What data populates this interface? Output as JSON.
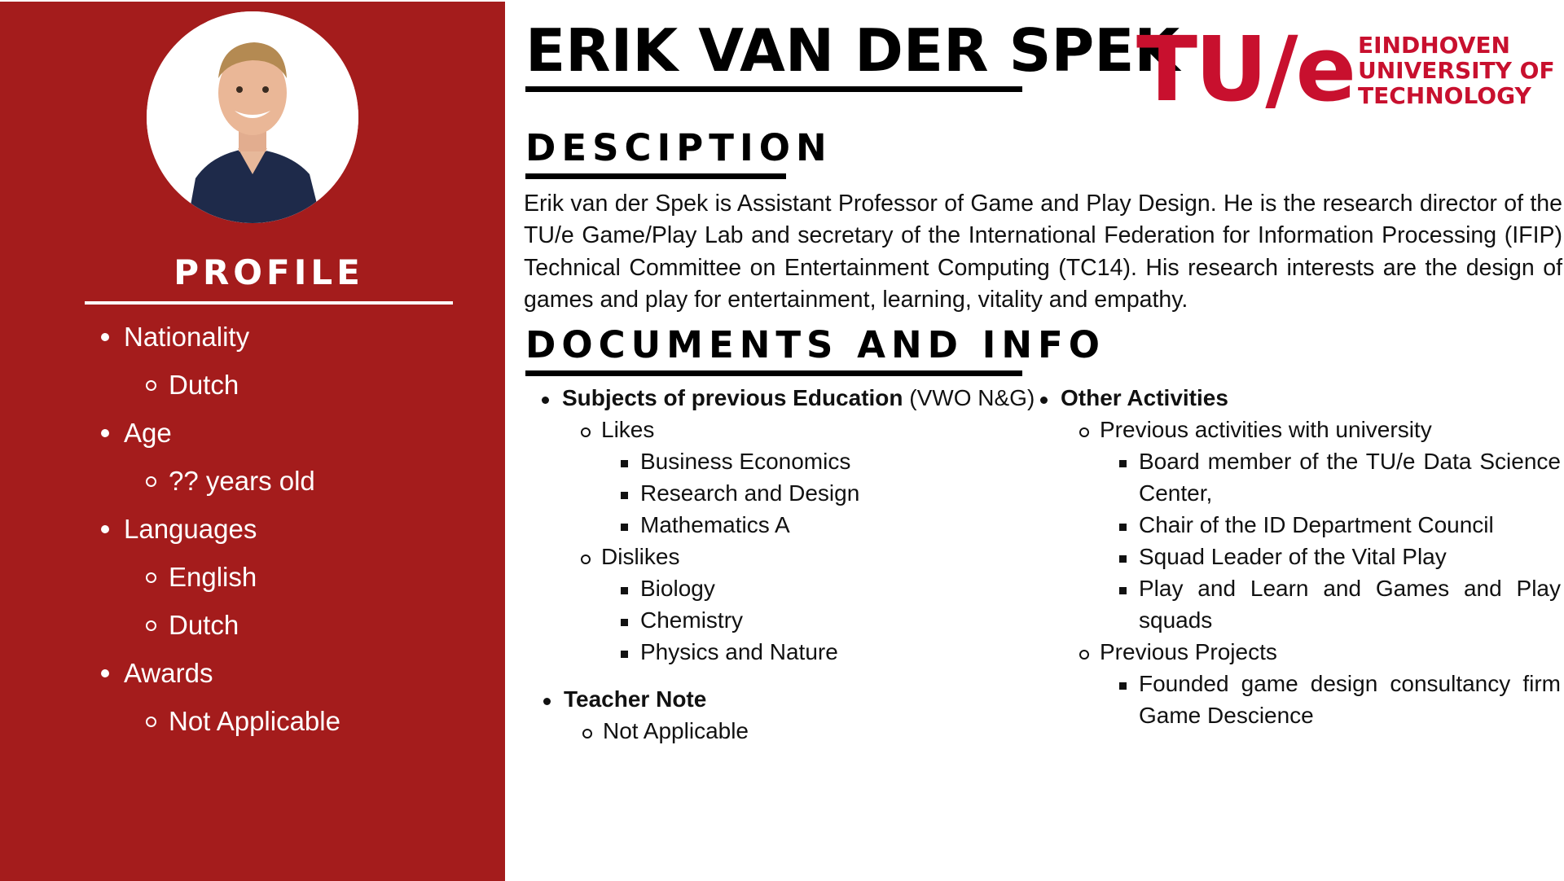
{
  "profile": {
    "title": "PROFILE",
    "photo_icon": "person-photo",
    "items": [
      {
        "label": "Nationality",
        "values": [
          "Dutch"
        ]
      },
      {
        "label": "Age",
        "values": [
          "?? years old"
        ]
      },
      {
        "label": "Languages",
        "values": [
          "English",
          "Dutch"
        ]
      },
      {
        "label": "Awards",
        "values": [
          "Not Applicable"
        ]
      }
    ]
  },
  "header": {
    "name": "ERIK VAN DER SPEK",
    "logo": {
      "mark": "TU/e",
      "line1": "EINDHOVEN",
      "line2": "UNIVERSITY OF",
      "line3": "TECHNOLOGY"
    }
  },
  "description": {
    "title": "DESCIPTION",
    "text": "Erik van der Spek is Assistant Professor of Game and Play Design. He is the research director of the TU/e Game/Play Lab and secretary of the International Federation for Information Processing (IFIP) Technical Committee on Entertainment Computing (TC14). His research interests are the design of games and play for entertainment, learning, vitality and empathy."
  },
  "documents": {
    "title": "DOCUMENTS AND INFO",
    "education": {
      "heading": "Subjects of previous Education",
      "heading_suffix": "(VWO N&G)",
      "likes_label": "Likes",
      "likes": [
        "Business Economics",
        "Research and Design",
        "Mathematics A"
      ],
      "dislikes_label": "Dislikes",
      "dislikes": [
        "Biology",
        "Chemistry",
        "Physics and Nature"
      ]
    },
    "teacher_note": {
      "heading": "Teacher Note",
      "value": "Not Applicable"
    },
    "other": {
      "heading": "Other Activities",
      "university_label": "Previous activities with university",
      "university_items": [
        "Board member of the TU/e Data Science",
        "Center,",
        "Chair of the ID Department Council",
        "Squad Leader of the Vital Play",
        "Play and Learn and Games and Play",
        "squads"
      ],
      "projects_label": "Previous Projects",
      "projects_items": [
        "Founded game design consultancy firm",
        "Game Descience"
      ]
    }
  },
  "colors": {
    "sidebar_red": "#a41c1c",
    "logo_red": "#c8102e"
  }
}
